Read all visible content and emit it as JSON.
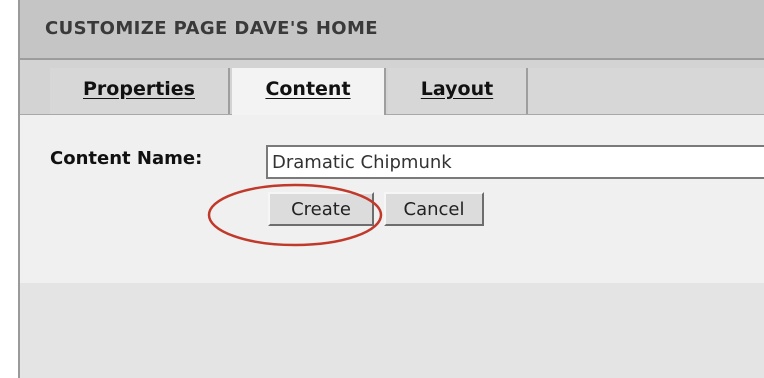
{
  "window": {
    "title": "CUSTOMIZE PAGE DAVE'S HOME"
  },
  "tabs": [
    {
      "label": "Properties",
      "active": false
    },
    {
      "label": "Content",
      "active": true
    },
    {
      "label": "Layout",
      "active": false
    }
  ],
  "form": {
    "content_name_label": "Content Name:",
    "content_name_value": "Dramatic Chipmunk",
    "create_label": "Create",
    "cancel_label": "Cancel"
  },
  "annotation": {
    "shape": "ellipse",
    "color": "#c0392b",
    "target": "create-button"
  }
}
